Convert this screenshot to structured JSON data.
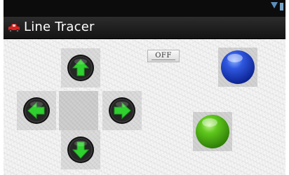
{
  "app": {
    "title": "Line Tracer",
    "icon": "car-icon"
  },
  "toggle": {
    "label": "OFF",
    "state": "off"
  },
  "controls": {
    "up": {
      "icon": "arrow-up-icon"
    },
    "down": {
      "icon": "arrow-down-icon"
    },
    "left": {
      "icon": "arrow-left-icon"
    },
    "right": {
      "icon": "arrow-right-icon"
    }
  },
  "indicators": {
    "blue": {
      "color": "#1a3fc4",
      "icon": "blue-led-icon"
    },
    "green": {
      "color": "#4fb214",
      "icon": "green-led-icon"
    }
  },
  "colors": {
    "status_bar": "#0c0c0c",
    "title_bar": "#1e1e1e",
    "arrow": "#2fd12f"
  }
}
